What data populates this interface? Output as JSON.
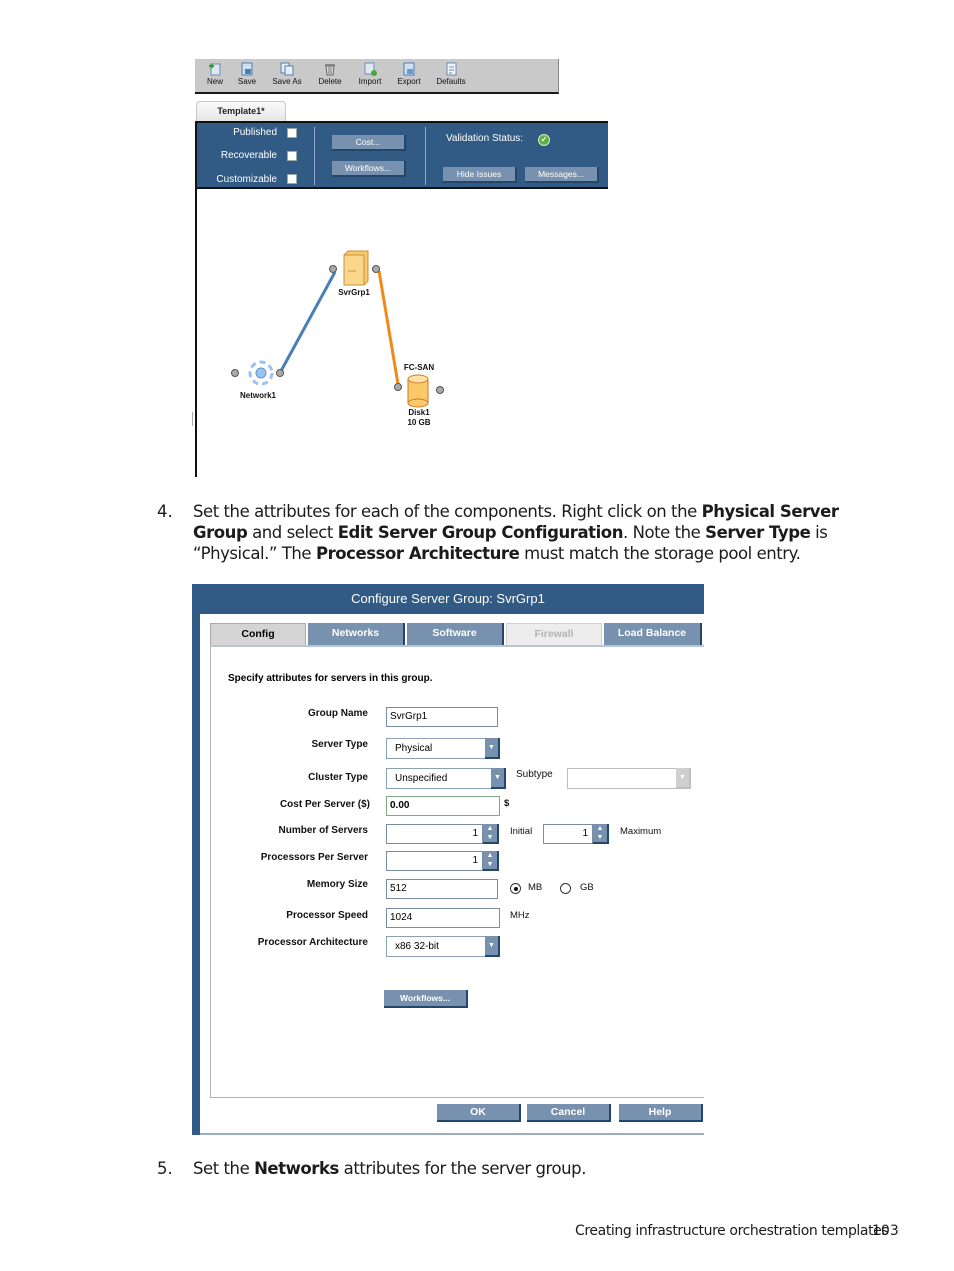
{
  "editor": {
    "toolbar": [
      {
        "label": "New",
        "icon": "new-document-icon"
      },
      {
        "label": "Save",
        "icon": "save-icon"
      },
      {
        "label": "Save As",
        "icon": "save-as-icon"
      },
      {
        "label": "Delete",
        "icon": "trash-icon"
      },
      {
        "label": "Import",
        "icon": "import-icon"
      },
      {
        "label": "Export",
        "icon": "export-icon"
      },
      {
        "label": "Defaults",
        "icon": "defaults-icon"
      }
    ],
    "tab_label": "Template1*",
    "properties": {
      "published_label": "Published",
      "published": false,
      "recoverable_label": "Recoverable",
      "recoverable": false,
      "customizable_label": "Customizable",
      "customizable": false,
      "cost_button": "Cost...",
      "workflows_button": "Workflows...",
      "validation_label": "Validation Status:",
      "validation_state": "valid",
      "hide_issues_button": "Hide Issues",
      "messages_button": "Messages..."
    },
    "diagram": {
      "nodes": [
        {
          "id": "svrgrp1",
          "label": "SvrGrp1",
          "type": "server-group"
        },
        {
          "id": "network1",
          "label": "Network1",
          "type": "network"
        },
        {
          "id": "disk1",
          "label": "Disk1",
          "sublabel": "10 GB",
          "toplabel": "FC-SAN",
          "type": "storage"
        }
      ],
      "links": [
        {
          "from": "network1",
          "to": "svrgrp1",
          "color": "#4a7fb5"
        },
        {
          "from": "svrgrp1",
          "to": "disk1",
          "color": "#f28a1a"
        }
      ]
    }
  },
  "steps": [
    {
      "number": "4.",
      "parts": [
        {
          "t": "Set the attributes for each of the components. Right click on the ",
          "b": false
        },
        {
          "t": "Physical Server Group",
          "b": true
        },
        {
          "t": " and select ",
          "b": false
        },
        {
          "t": "Edit Server Group Configuration",
          "b": true
        },
        {
          "t": ". Note the ",
          "b": false
        },
        {
          "t": "Server Type",
          "b": true
        },
        {
          "t": " is “Physical.” The ",
          "b": false
        },
        {
          "t": "Processor Architecture",
          "b": true
        },
        {
          "t": " must match the storage pool entry.",
          "b": false
        }
      ]
    },
    {
      "number": "5.",
      "parts": [
        {
          "t": "Set the ",
          "b": false
        },
        {
          "t": "Networks",
          "b": true
        },
        {
          "t": " attributes for the server group.",
          "b": false
        }
      ]
    }
  ],
  "dialog": {
    "title": "Configure Server Group: SvrGrp1",
    "tabs": [
      {
        "label": "Config",
        "state": "active"
      },
      {
        "label": "Networks",
        "state": "normal"
      },
      {
        "label": "Software",
        "state": "normal"
      },
      {
        "label": "Firewall",
        "state": "disabled"
      },
      {
        "label": "Load Balance",
        "state": "normal"
      }
    ],
    "intro": "Specify attributes for servers in this group.",
    "fields": {
      "group_name_label": "Group Name",
      "group_name": "SvrGrp1",
      "server_type_label": "Server Type",
      "server_type": "Physical",
      "cluster_type_label": "Cluster Type",
      "cluster_type": "Unspecified",
      "subtype_label": "Subtype",
      "subtype": "",
      "cost_label": "Cost Per Server ($)",
      "cost": "0.00",
      "cost_unit": "$",
      "num_servers_label": "Number of Servers",
      "num_servers_initial": "1",
      "initial_label": "Initial",
      "num_servers_max": "1",
      "maximum_label": "Maximum",
      "procs_label": "Processors Per Server",
      "procs": "1",
      "memory_label": "Memory Size",
      "memory": "512",
      "memory_unit_mb": "MB",
      "memory_unit_gb": "GB",
      "memory_unit_selected": "MB",
      "speed_label": "Processor Speed",
      "speed": "1024",
      "speed_unit": "MHz",
      "arch_label": "Processor Architecture",
      "arch": "x86 32-bit"
    },
    "workflows_button": "Workflows...",
    "ok_button": "OK",
    "cancel_button": "Cancel",
    "help_button": "Help"
  },
  "footer": {
    "title": "Creating infrastructure orchestration templates",
    "page": "103"
  }
}
